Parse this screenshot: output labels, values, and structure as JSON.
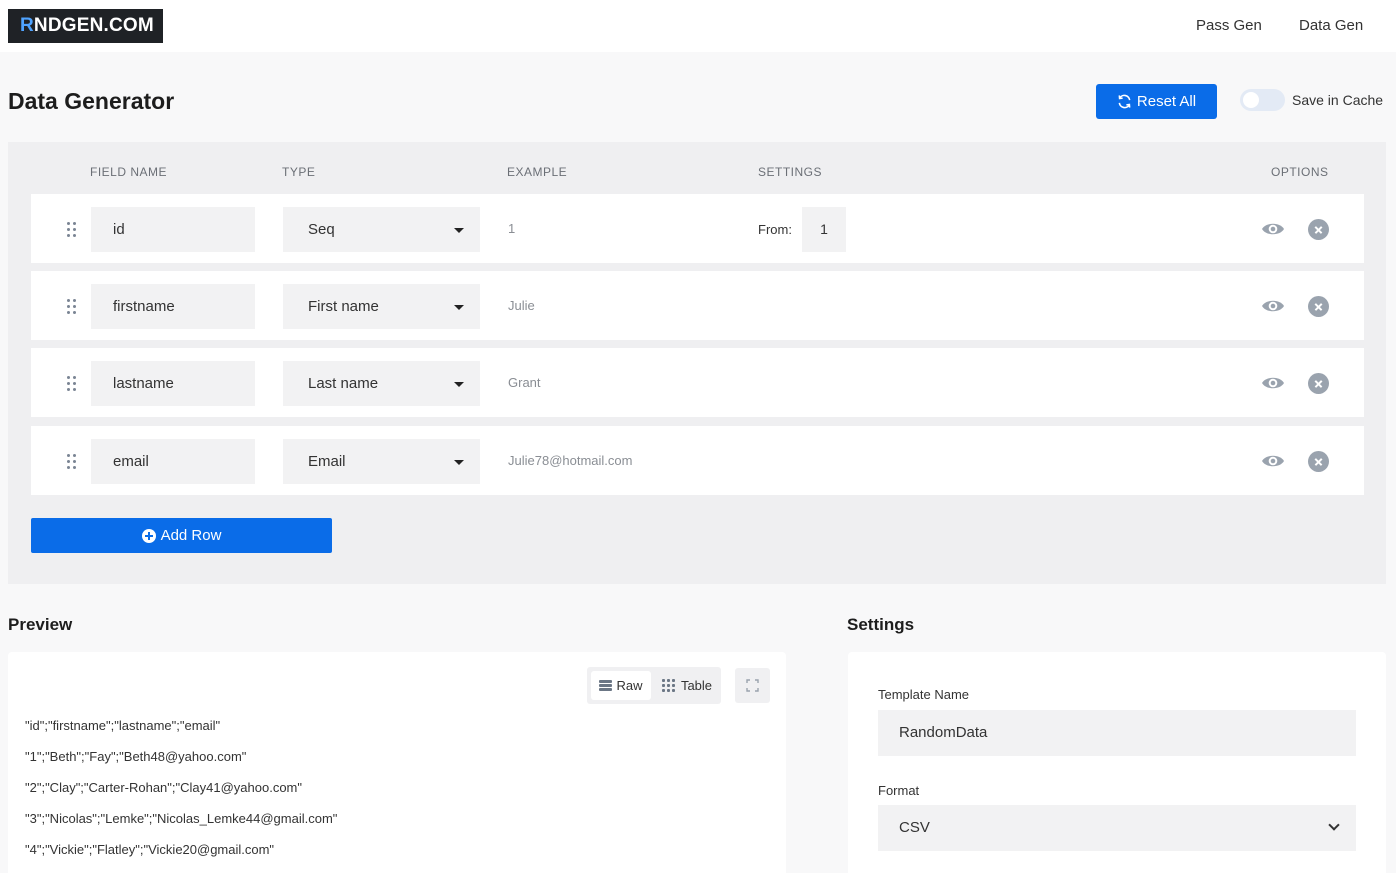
{
  "header": {
    "logo_r": "R",
    "logo_rest": "NDGEN.COM",
    "nav": [
      "Pass Gen",
      "Data Gen"
    ]
  },
  "title": "Data Generator",
  "actions": {
    "reset_label": "Reset All",
    "cache_label": "Save in Cache",
    "cache_enabled": false
  },
  "columns": {
    "field_name": "FIELD NAME",
    "type": "TYPE",
    "example": "EXAMPLE",
    "settings": "SETTINGS",
    "options": "OPTIONS"
  },
  "rows": [
    {
      "name": "id",
      "type": "Seq",
      "example": "1",
      "from_label": "From:",
      "from_value": "1"
    },
    {
      "name": "firstname",
      "type": "First name",
      "example": "Julie"
    },
    {
      "name": "lastname",
      "type": "Last name",
      "example": "Grant"
    },
    {
      "name": "email",
      "type": "Email",
      "example": "Julie78@hotmail.com"
    }
  ],
  "add_row_label": "Add Row",
  "preview": {
    "title": "Preview",
    "raw_label": "Raw",
    "table_label": "Table",
    "lines": [
      "\"id\";\"firstname\";\"lastname\";\"email\"",
      "\"1\";\"Beth\";\"Fay\";\"Beth48@yahoo.com\"",
      "\"2\";\"Clay\";\"Carter-Rohan\";\"Clay41@yahoo.com\"",
      "\"3\";\"Nicolas\";\"Lemke\";\"Nicolas_Lemke44@gmail.com\"",
      "\"4\";\"Vickie\";\"Flatley\";\"Vickie20@gmail.com\""
    ]
  },
  "settings": {
    "title": "Settings",
    "template_label": "Template Name",
    "template_value": "RandomData",
    "format_label": "Format",
    "format_value": "CSV"
  },
  "colors": {
    "primary": "#0a6ce8",
    "logo_bg": "#1f2226"
  }
}
